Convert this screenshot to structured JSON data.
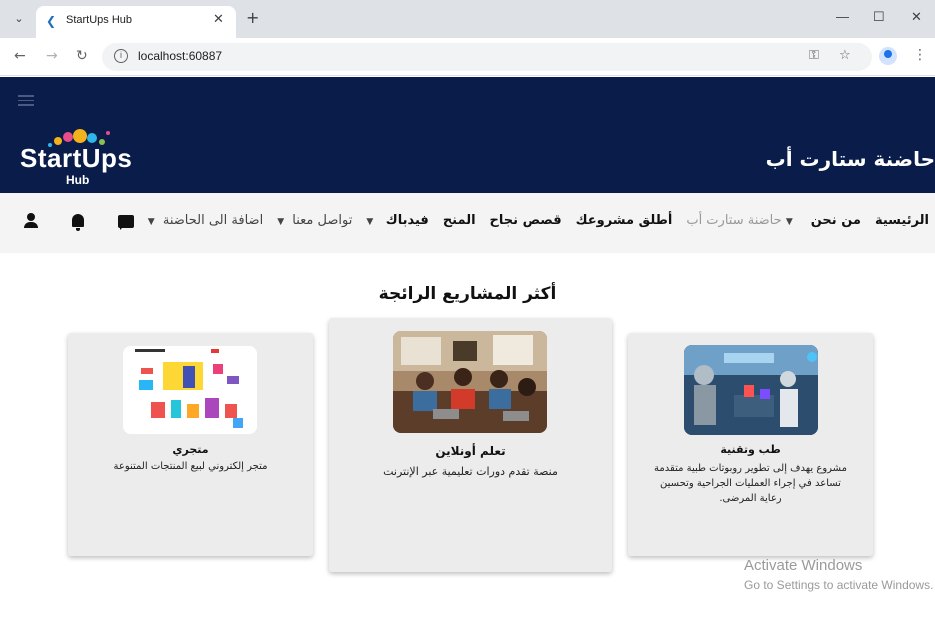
{
  "browser": {
    "tab_title": "StartUps Hub",
    "tab_close": "✕",
    "new_tab": "+",
    "minimize": "—",
    "maximize": "☐",
    "close": "✕",
    "url": "localhost:60887"
  },
  "header": {
    "logo_word": "StartUps",
    "logo_sub": "Hub",
    "site_title": "حاضنة ستارت أب"
  },
  "nav": {
    "home": "الرئيسية",
    "about": "من نحن",
    "incubator": "حاضنة ستارت أب",
    "launch": "أطلق مشروعك",
    "stories": "قصص نجاح",
    "grants": "المنح",
    "feedback": "فيدباك",
    "contact": "تواصل معنا",
    "add_to_incubator": "اضافة الى الحاضنة"
  },
  "section": {
    "title": "أكثر المشاريع الرائجة"
  },
  "cards": [
    {
      "title": "متجري",
      "desc": "متجر إلكتروني لبيع المنتجات المتنوعة"
    },
    {
      "title": "تعلم أونلاين",
      "desc": "منصة تقدم دورات تعليمية عبر الإنترنت"
    },
    {
      "title": "طب وتقنية",
      "desc": "مشروع يهدف إلى تطوير روبوتات طبية متقدمة تساعد في إجراء العمليات الجراحية وتحسين رعاية المرضى."
    }
  ],
  "watermark": {
    "line1": "Activate Windows",
    "line2": "Go to Settings to activate Windows."
  },
  "colors": {
    "header_bg": "#0a1d4a",
    "navbar_bg": "#f4f4f4",
    "card_bg": "#ececec"
  }
}
